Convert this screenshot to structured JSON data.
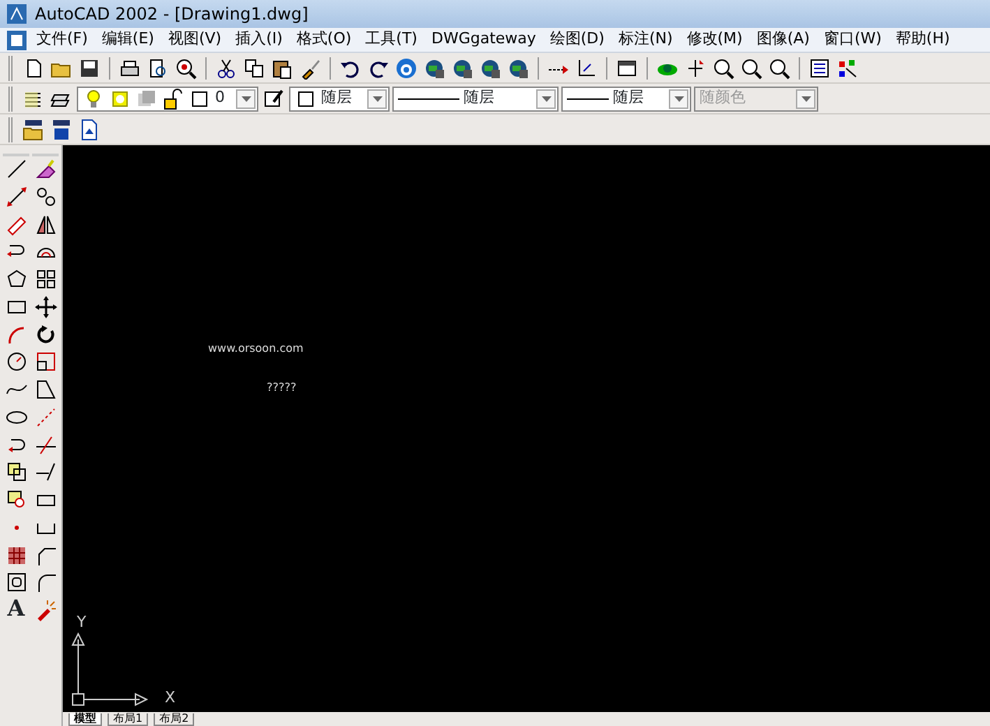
{
  "window": {
    "title": "AutoCAD 2002 - [Drawing1.dwg]"
  },
  "menu": [
    {
      "label": "文件(F)"
    },
    {
      "label": "编辑(E)"
    },
    {
      "label": "视图(V)"
    },
    {
      "label": "插入(I)"
    },
    {
      "label": "格式(O)"
    },
    {
      "label": "工具(T)"
    },
    {
      "label": "DWGgateway"
    },
    {
      "label": "绘图(D)"
    },
    {
      "label": "标注(N)"
    },
    {
      "label": "修改(M)"
    },
    {
      "label": "图像(A)"
    },
    {
      "label": "窗口(W)"
    },
    {
      "label": "帮助(H)"
    }
  ],
  "layer_toolbar": {
    "layer": "0",
    "color_setting": "随层",
    "linetype": "随层",
    "lineweight": "随层",
    "plot_style": {
      "value": "随颜色",
      "disabled": true
    }
  },
  "draw_toolbar": {
    "text_tool": "A"
  },
  "canvas": {
    "texts": [
      "www.orsoon.com",
      "?????"
    ],
    "ucs": {
      "x": "X",
      "y": "Y"
    }
  },
  "layout_tabs": [
    {
      "label": "模型",
      "selected": true
    },
    {
      "label": "布局1",
      "selected": false
    },
    {
      "label": "布局2",
      "selected": false
    }
  ]
}
